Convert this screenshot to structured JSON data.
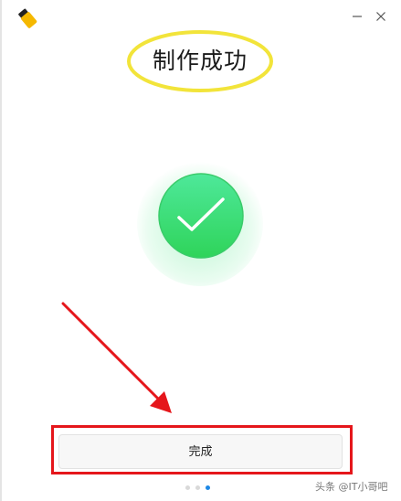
{
  "window": {
    "title": "制作成功",
    "minimize_glyph": "minimize-icon",
    "close_glyph": "close-icon"
  },
  "app": {
    "icon": "usb-drive-icon",
    "icon_color": "#f5b800"
  },
  "result": {
    "status": "success",
    "icon": "checkmark-icon",
    "icon_color": "#3dd86a"
  },
  "footer": {
    "done_label": "完成",
    "pager_total": 3,
    "pager_active": 3
  },
  "annotation": {
    "ellipse_color": "#f2e43a",
    "arrow_color": "#e5161b",
    "box_color": "#e5161b"
  },
  "watermark": {
    "text": "头条 @IT小哥吧"
  }
}
